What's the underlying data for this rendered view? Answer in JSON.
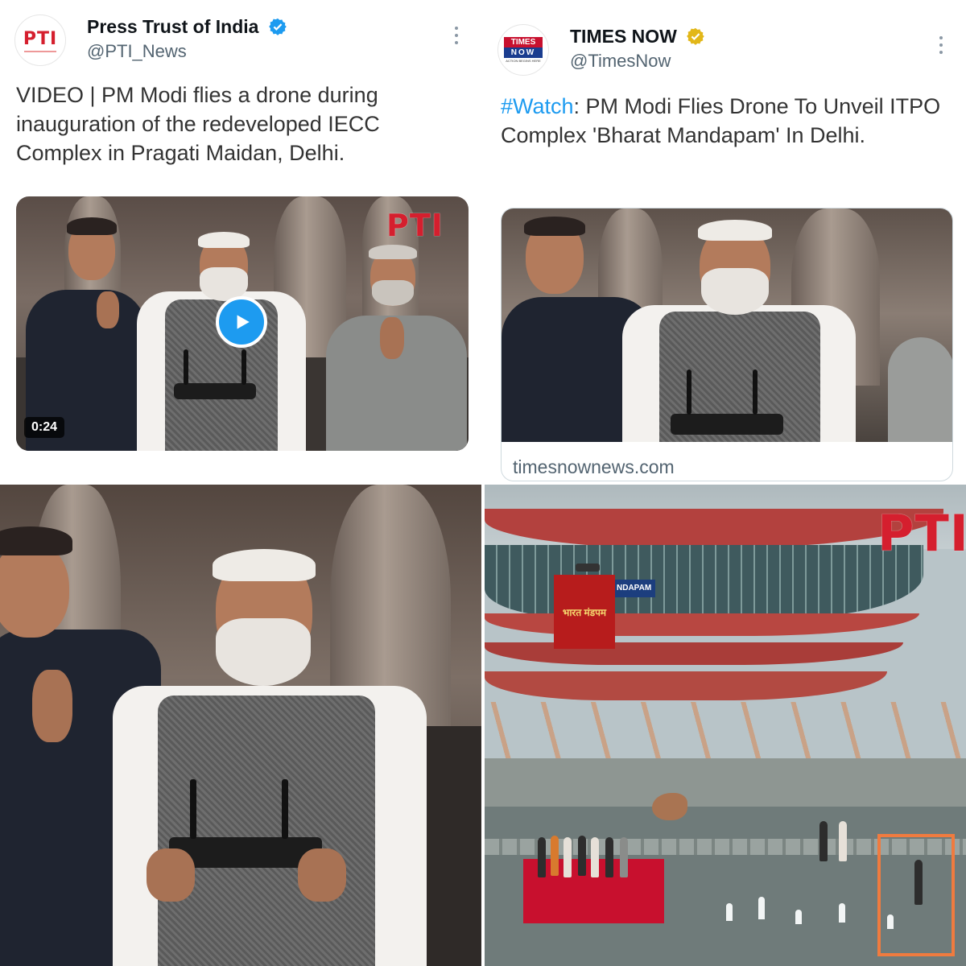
{
  "tweet1": {
    "account_name": "Press Trust of India",
    "handle": "@PTI_News",
    "avatar_text": "PTI",
    "verified_color": "#1d9bf0",
    "text": "VIDEO | PM Modi flies a drone during inauguration of the redeveloped IECC Complex in Pragati Maidan, Delhi.",
    "video_duration": "0:24",
    "watermark": "PTI",
    "media_icon": "play-icon"
  },
  "tweet2": {
    "account_name": "TIMES NOW",
    "handle": "@TimesNow",
    "avatar_line1": "TIMES",
    "avatar_line2": "NOW",
    "avatar_tagline": "ACTION BEGINS HERE",
    "verified_color": "#e2b719",
    "hashtag": "#Watch",
    "text_rest": ": PM Modi Flies Drone To Unveil ITPO Complex 'Bharat Mandapam' In Delhi.",
    "link_domain": "timesnownews.com"
  },
  "panel4": {
    "watermark": "PTI",
    "banner_text": "भारत मंडपम",
    "sign_text": "NDAPAM",
    "highlight_color": "#f07b3f"
  },
  "colors": {
    "link_blue": "#1d9bf0",
    "handle_grey": "#536471",
    "pti_red": "#d51f2e",
    "times_red": "#c8102e"
  }
}
